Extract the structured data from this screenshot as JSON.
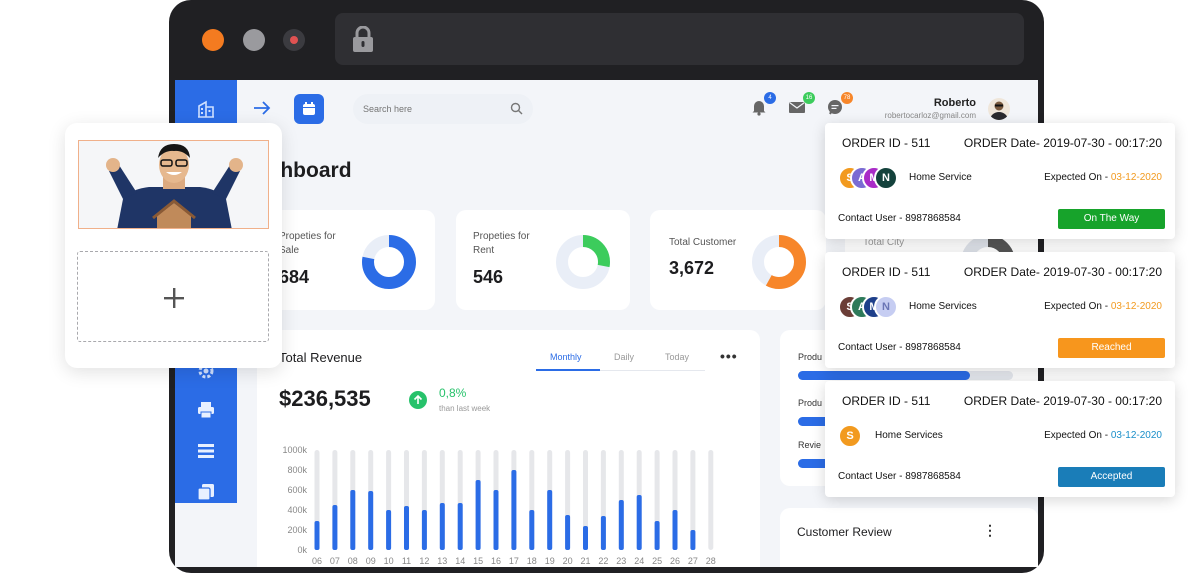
{
  "browser": {
    "window_dots": [
      "orange",
      "gray",
      "record"
    ],
    "icons": [
      "lock-icon"
    ]
  },
  "header": {
    "search_placeholder": "Search here",
    "notifications": {
      "bell": "4",
      "mail": "16",
      "chat": "78"
    },
    "user": {
      "name": "Roberto",
      "email": "robertocarloz@gmail.com"
    }
  },
  "page": {
    "title": "ashboard"
  },
  "stats": [
    {
      "label": "Propeties for Sale",
      "value": "684",
      "fraction": 0.78,
      "color": "#2b6ce6"
    },
    {
      "label": "Propeties for Rent",
      "value": "546",
      "fraction": 0.28,
      "color": "#3ccc5c"
    },
    {
      "label": "Total Customer",
      "value": "3,672",
      "fraction": 0.58,
      "color": "#f7862a"
    },
    {
      "label": "Total City",
      "value": ""
    }
  ],
  "revenue": {
    "title": "Total Revenue",
    "tabs": [
      "Monthly",
      "Daily",
      "Today"
    ],
    "active_tab": "Monthly",
    "amount": "$236,535",
    "change": "0,8%",
    "change_sub": "than last week"
  },
  "chart_data": {
    "type": "bar",
    "categories": [
      "06",
      "07",
      "08",
      "09",
      "10",
      "11",
      "12",
      "13",
      "14",
      "15",
      "16",
      "17",
      "18",
      "19",
      "20",
      "21",
      "22",
      "23",
      "24",
      "25",
      "26",
      "27",
      "28"
    ],
    "values": [
      290,
      450,
      600,
      590,
      400,
      440,
      400,
      470,
      470,
      700,
      600,
      800,
      400,
      600,
      350,
      240,
      340,
      500,
      550,
      290,
      400,
      200,
      0
    ],
    "ytick_labels": [
      "1000k",
      "800k",
      "600k",
      "400k",
      "200k",
      "0k"
    ],
    "ylim": [
      0,
      1000
    ],
    "track_max": 1000,
    "bar_color": "#2b6ce6",
    "track_color": "#e6e7ea",
    "title": "",
    "xlabel": "",
    "ylabel": ""
  },
  "right_panel": {
    "labels": [
      "Produ",
      "Produ",
      "Revie"
    ],
    "progress": [
      0.8,
      0.3,
      0.3
    ],
    "review_title": "Customer Review"
  },
  "orders": [
    {
      "id": "ORDER ID - 511",
      "date": "ORDER  Date- 2019-07-30 - 00:17:20",
      "avatars": [
        {
          "letter": "S",
          "color": "#f29a1f"
        },
        {
          "letter": "A",
          "color": "#7b6bd3"
        },
        {
          "letter": "M",
          "color": "#a92bc7"
        },
        {
          "letter": "N",
          "color": "#14423c"
        }
      ],
      "service": "Home Service",
      "expected_label": "Expected On - ",
      "expected_date": "03-12-2020",
      "contact": "Contact User - 8987868584",
      "status": "On The Way",
      "status_color": "#17a32b"
    },
    {
      "id": "ORDER ID - 511",
      "date": "ORDER  Date- 2019-07-30 - 00:17:20",
      "avatars": [
        {
          "letter": "S",
          "color": "#6b3e37"
        },
        {
          "letter": "A",
          "color": "#2e7a5a"
        },
        {
          "letter": "M",
          "color": "#1e3f8a"
        },
        {
          "letter": "N",
          "color": "#c6cdf2"
        }
      ],
      "service": "Home Services",
      "expected_label": "Expected On - ",
      "expected_date": "03-12-2020",
      "contact": "Contact User - 8987868584",
      "status": "Reached",
      "status_color": "#f7961d"
    },
    {
      "id": "ORDER ID - 511",
      "date": "ORDER  Date- 2019-07-30 - 00:17:20",
      "avatars": [
        {
          "letter": "S",
          "color": "#f29a1f"
        }
      ],
      "service": "Home Services",
      "expected_label": "Expected On - ",
      "expected_date": "03-12-2020",
      "contact": "Contact User - 8987868584",
      "status": "Accepted",
      "status_color": "#1a7db8"
    }
  ]
}
